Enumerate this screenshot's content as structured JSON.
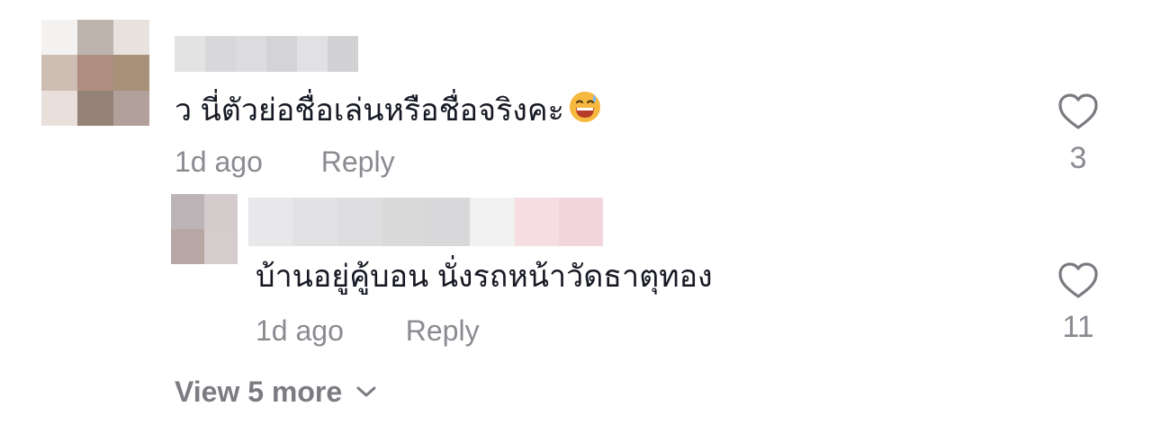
{
  "comments": [
    {
      "text": "ว นี่ตัวย่อชื่อเล่นหรือชื่อจริงคะ",
      "emoji": "grinning-sweat-emoji",
      "time": "1d ago",
      "reply_label": "Reply",
      "likes": "3",
      "avatar_colors": [
        "#f4f2f0",
        "#bdb3ad",
        "#e8e2de",
        "#cdbdb3",
        "#ad8e81",
        "#a89079",
        "#e9e0dc",
        "#958377",
        "#b2a09a"
      ],
      "name_colors": [
        "#e4e3e4",
        "#d8d7d9",
        "#dcdcde",
        "#d4d4d6",
        "#e1e0e2",
        "#d2d1d3"
      ]
    }
  ],
  "reply": {
    "text": "บ้านอยู่คู้บอน นั่งรถหน้าวัดธาตุทอง",
    "time": "1d ago",
    "reply_label": "Reply",
    "likes": "11",
    "avatar_colors": [
      "#bdb4b7",
      "#d4cbcd",
      "#b7a8a5",
      "#d5cdcd"
    ],
    "name_colors": [
      "#e8e8ea",
      "#e2e2e4",
      "#dedee0",
      "#dadada",
      "#d8d8da",
      "#f1f1f1",
      "#f6dde1",
      "#f3d6dc"
    ]
  },
  "view_more": {
    "label": "View 5 more"
  },
  "colors": {
    "text": "#161823",
    "muted": "#8a8b91",
    "icon": "#7a7b80"
  }
}
